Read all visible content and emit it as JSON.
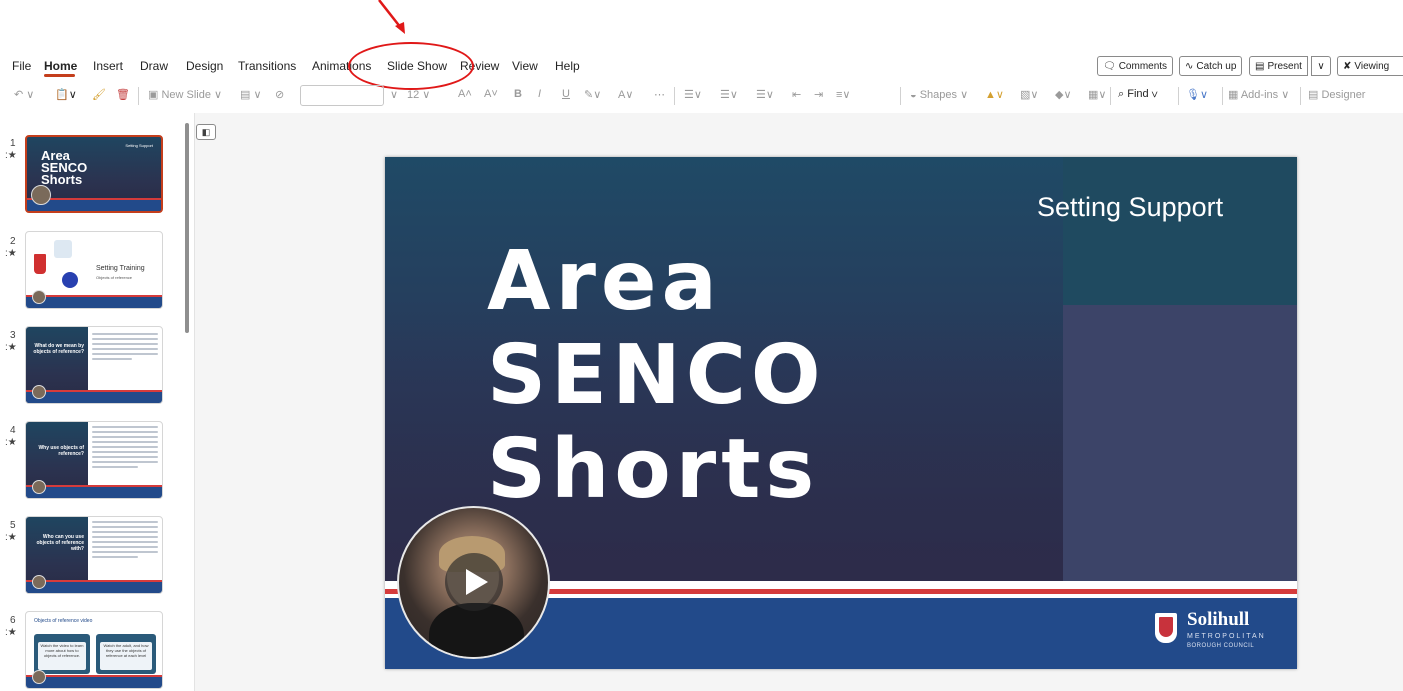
{
  "menu": {
    "items": [
      "File",
      "Home",
      "Insert",
      "Draw",
      "Design",
      "Transitions",
      "Animations",
      "Slide Show",
      "Review",
      "View",
      "Help"
    ],
    "active": "Home"
  },
  "ribbon_right": {
    "comments": "Comments",
    "catch_up": "Catch up",
    "present": "Present",
    "viewing": "Viewing"
  },
  "toolbar": {
    "new_slide": "New Slide",
    "font_size": "12",
    "shapes": "Shapes",
    "find": "Find",
    "addins": "Add-ins",
    "designer": "Designer"
  },
  "thumbnails": [
    {
      "num": "1",
      "title": "Area SENCO Shorts",
      "tag": "Setting Support"
    },
    {
      "num": "2",
      "title": "Setting Training",
      "subtitle": "Objects of reference"
    },
    {
      "num": "3",
      "title": "What do we mean by objects of reference?"
    },
    {
      "num": "4",
      "title": "Why use objects of reference?"
    },
    {
      "num": "5",
      "title": "Who can you use objects of reference with?"
    },
    {
      "num": "6",
      "title": "Objects of reference video",
      "box1": "Watch the video to learn more about how to objects of reference.",
      "box2": "Watch the adult, and how they use the objects of reference at each level"
    }
  ],
  "slide": {
    "subtitle": "Setting Support",
    "title_line1": "Area",
    "title_line2": "SENCO",
    "title_line3": "Shorts",
    "logo_name": "Solihull",
    "logo_sub1": "METROPOLITAN",
    "logo_sub2": "BOROUGH COUNCIL"
  },
  "colors": {
    "accent": "#c43e1c",
    "annotation": "#e01818",
    "slide_blue": "#224a8a",
    "slide_red": "#d53b3b"
  }
}
